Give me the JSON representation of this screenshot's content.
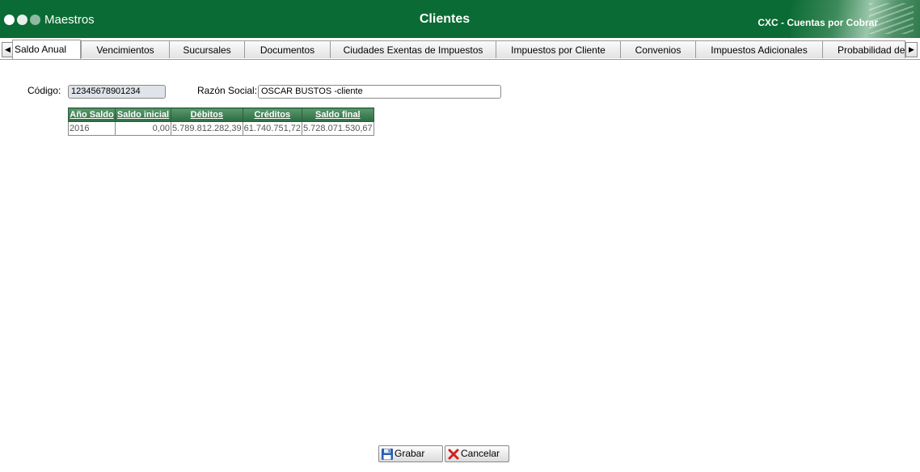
{
  "header": {
    "section": "Maestros",
    "title": "Clientes",
    "module": "CXC - Cuentas por Cobrar"
  },
  "tabs": [
    {
      "label": "Saldo Anual",
      "active": true
    },
    {
      "label": "Vencimientos"
    },
    {
      "label": "Sucursales"
    },
    {
      "label": "Documentos"
    },
    {
      "label": "Ciudades Exentas de Impuestos"
    },
    {
      "label": "Impuestos por Cliente"
    },
    {
      "label": "Convenios"
    },
    {
      "label": "Impuestos Adicionales"
    },
    {
      "label": "Probabilidad de"
    }
  ],
  "form": {
    "codigo_label": "Código:",
    "codigo_value": "12345678901234",
    "razon_label": "Razón Social:",
    "razon_value": "OSCAR BUSTOS -cliente"
  },
  "grid": {
    "columns": [
      "Año Saldo",
      "Saldo inicial",
      "Débitos",
      "Créditos",
      "Saldo final"
    ],
    "rows": [
      [
        "2016",
        "0,00",
        "5.789.812.282,39",
        "61.740.751,72",
        "5.728.071.530,67"
      ]
    ]
  },
  "buttons": {
    "save_label": "Grabar",
    "cancel_label": "Cancelar"
  },
  "colors": {
    "header_bg": "#0b6b34",
    "grid_header": "#2c6b41"
  }
}
